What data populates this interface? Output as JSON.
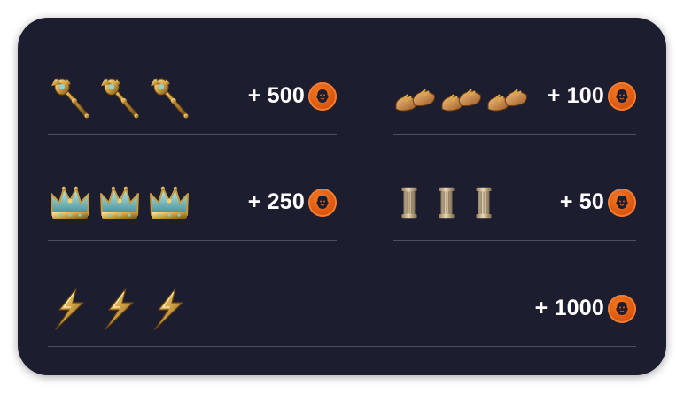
{
  "paytable": {
    "rows": [
      {
        "symbol_icon": "scepter-icon",
        "count": 3,
        "reward": "+ 500"
      },
      {
        "symbol_icon": "sandals-icon",
        "count": 3,
        "reward": "+ 100"
      },
      {
        "symbol_icon": "crown-icon",
        "count": 3,
        "reward": "+ 250"
      },
      {
        "symbol_icon": "pillar-icon",
        "count": 3,
        "reward": "+ 50"
      },
      {
        "symbol_icon": "lightning-icon",
        "count": 3,
        "reward": "+ 1000"
      }
    ],
    "coin_icon": "lion-coin-icon"
  },
  "colors": {
    "panel_background": "#1d1d30",
    "divider": "#4e4e62",
    "coin": "#e15a10",
    "text": "#ffffff",
    "gold": "#d9a94a"
  }
}
